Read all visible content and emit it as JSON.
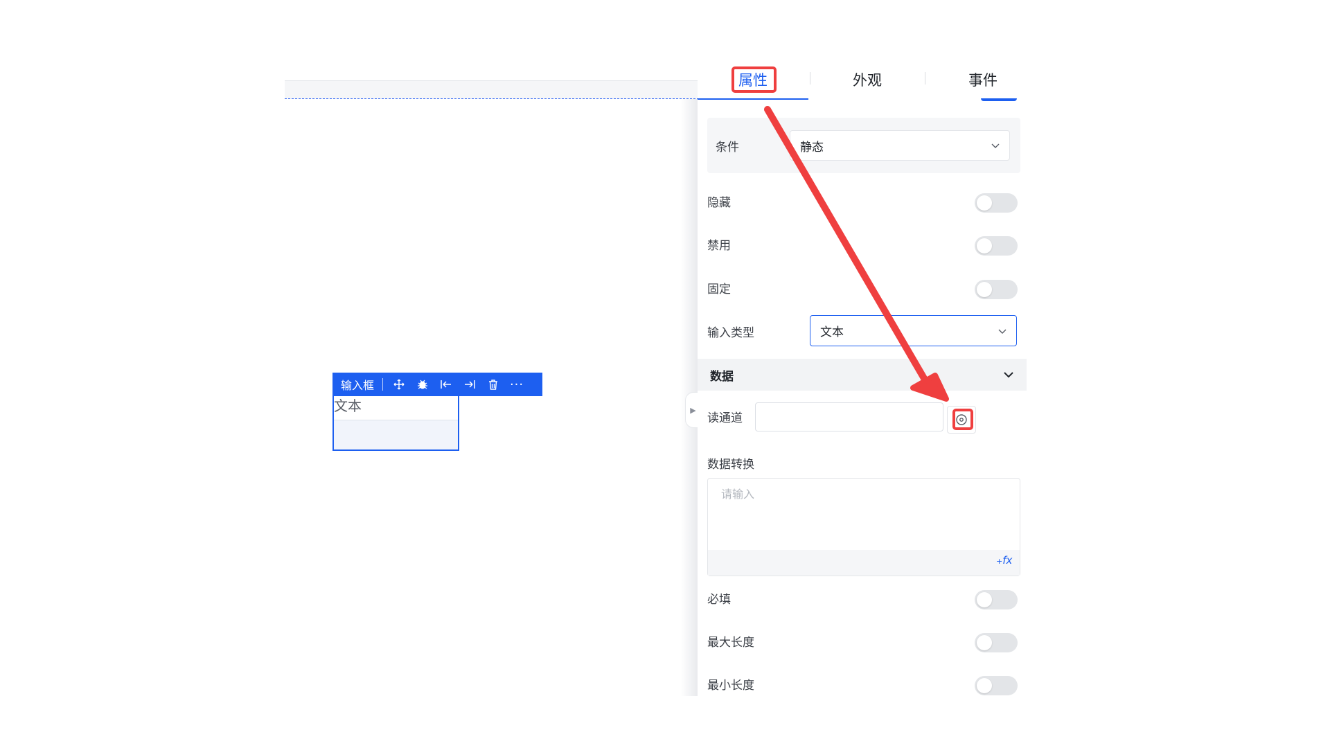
{
  "canvas": {
    "component_toolbar": {
      "label": "输入框",
      "icons": [
        "move-icon",
        "bug-icon",
        "align-left-icon",
        "align-right-icon",
        "trash-icon",
        "more-icon"
      ]
    },
    "component_text": "文本"
  },
  "panel": {
    "tabs": [
      {
        "label": "属性",
        "active": true
      },
      {
        "label": "外观",
        "active": false
      },
      {
        "label": "事件",
        "active": false
      }
    ],
    "condition": {
      "label": "条件",
      "value": "静态"
    },
    "toggles_top": [
      {
        "label": "隐藏",
        "on": false
      },
      {
        "label": "禁用",
        "on": false
      },
      {
        "label": "固定",
        "on": false
      }
    ],
    "input_type": {
      "label": "输入类型",
      "value": "文本"
    },
    "data_section": {
      "title": "数据",
      "read_channel": {
        "label": "读通道",
        "value": ""
      },
      "transform": {
        "label": "数据转换",
        "placeholder": "请输入",
        "fx_label": "fx"
      }
    },
    "toggles_bottom": [
      {
        "label": "必填",
        "on": false
      },
      {
        "label": "最大长度",
        "on": false
      },
      {
        "label": "最小长度",
        "on": false
      }
    ]
  },
  "colors": {
    "accent": "#1d5ff0",
    "annotation": "#ef3f3f",
    "toggle_off": "#e3e5e8"
  }
}
